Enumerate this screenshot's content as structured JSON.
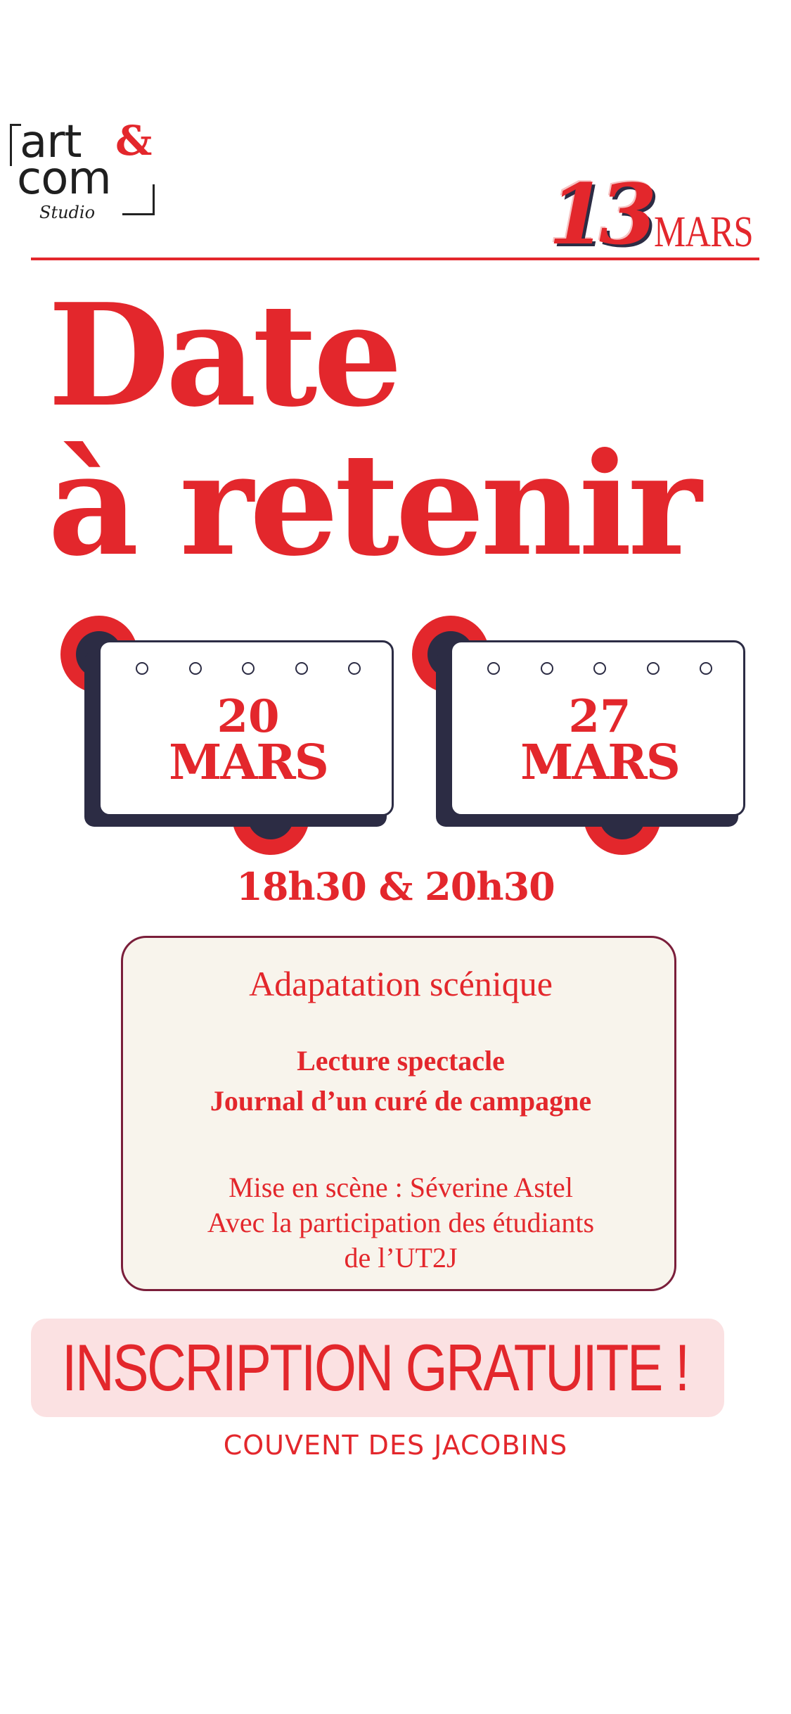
{
  "logo": {
    "line1": "art",
    "amp": "&",
    "line2": "com",
    "studio": "Studio"
  },
  "top_date": {
    "day": "13",
    "month": "MARS"
  },
  "headline": {
    "line1": "Date",
    "line2": "à retenir"
  },
  "calendars": [
    {
      "day": "20",
      "month": "MARS"
    },
    {
      "day": "27",
      "month": "MARS"
    }
  ],
  "times": "18h30 & 20h30",
  "info": {
    "title": "Adapatation scénique",
    "subtitle_line1": "Lecture spectacle",
    "subtitle_line2": "Journal d’un curé de campagne",
    "credit_line1": "Mise en scène : Séverine Astel",
    "credit_line2": "Avec la participation des étudiants",
    "credit_line3": "de l’UT2J"
  },
  "link_sticker": {
    "icon": "link-icon",
    "label": "INSCRIPTION GRATUITE !"
  },
  "venue": "COUVENT DES JACOBINS",
  "colors": {
    "red": "#e3272c",
    "navy": "#2c2c44",
    "box_bg": "#f8f4ec",
    "box_border": "#7a1e3a",
    "sticker_bg": "#fbe1e2"
  }
}
